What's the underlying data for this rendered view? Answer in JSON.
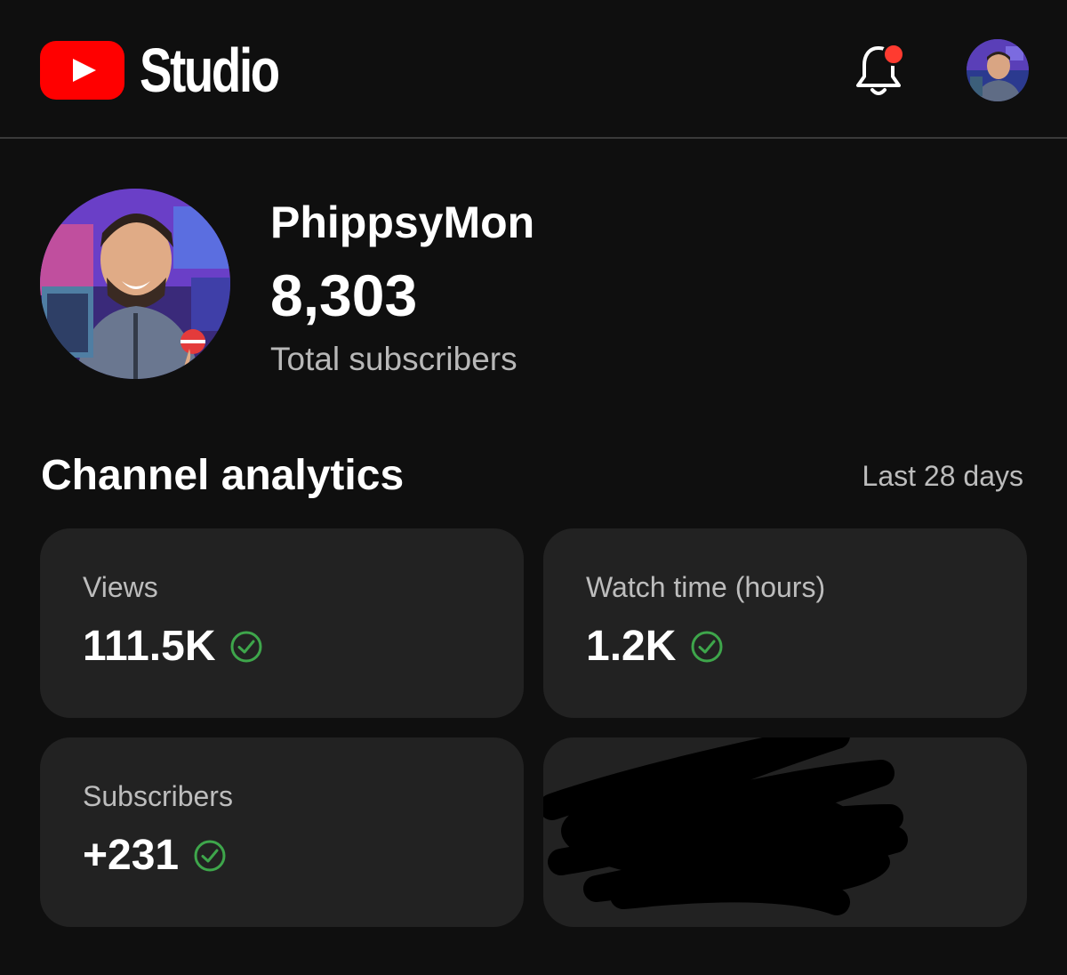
{
  "header": {
    "logo_text": "Studio",
    "brand_red": "#ff0000",
    "notification_dot_color": "#ff3b30"
  },
  "channel": {
    "name": "PhippsyMon",
    "subscriber_count": "8,303",
    "subscriber_label": "Total subscribers"
  },
  "analytics": {
    "title": "Channel analytics",
    "period": "Last 28 days",
    "cards": [
      {
        "label": "Views",
        "value": "111.5K",
        "status_icon": "check-circle-icon"
      },
      {
        "label": "Watch time (hours)",
        "value": "1.2K",
        "status_icon": "check-circle-icon"
      },
      {
        "label": "Subscribers",
        "value": "+231",
        "status_icon": "check-circle-icon"
      }
    ],
    "check_color": "#3ea64b"
  }
}
